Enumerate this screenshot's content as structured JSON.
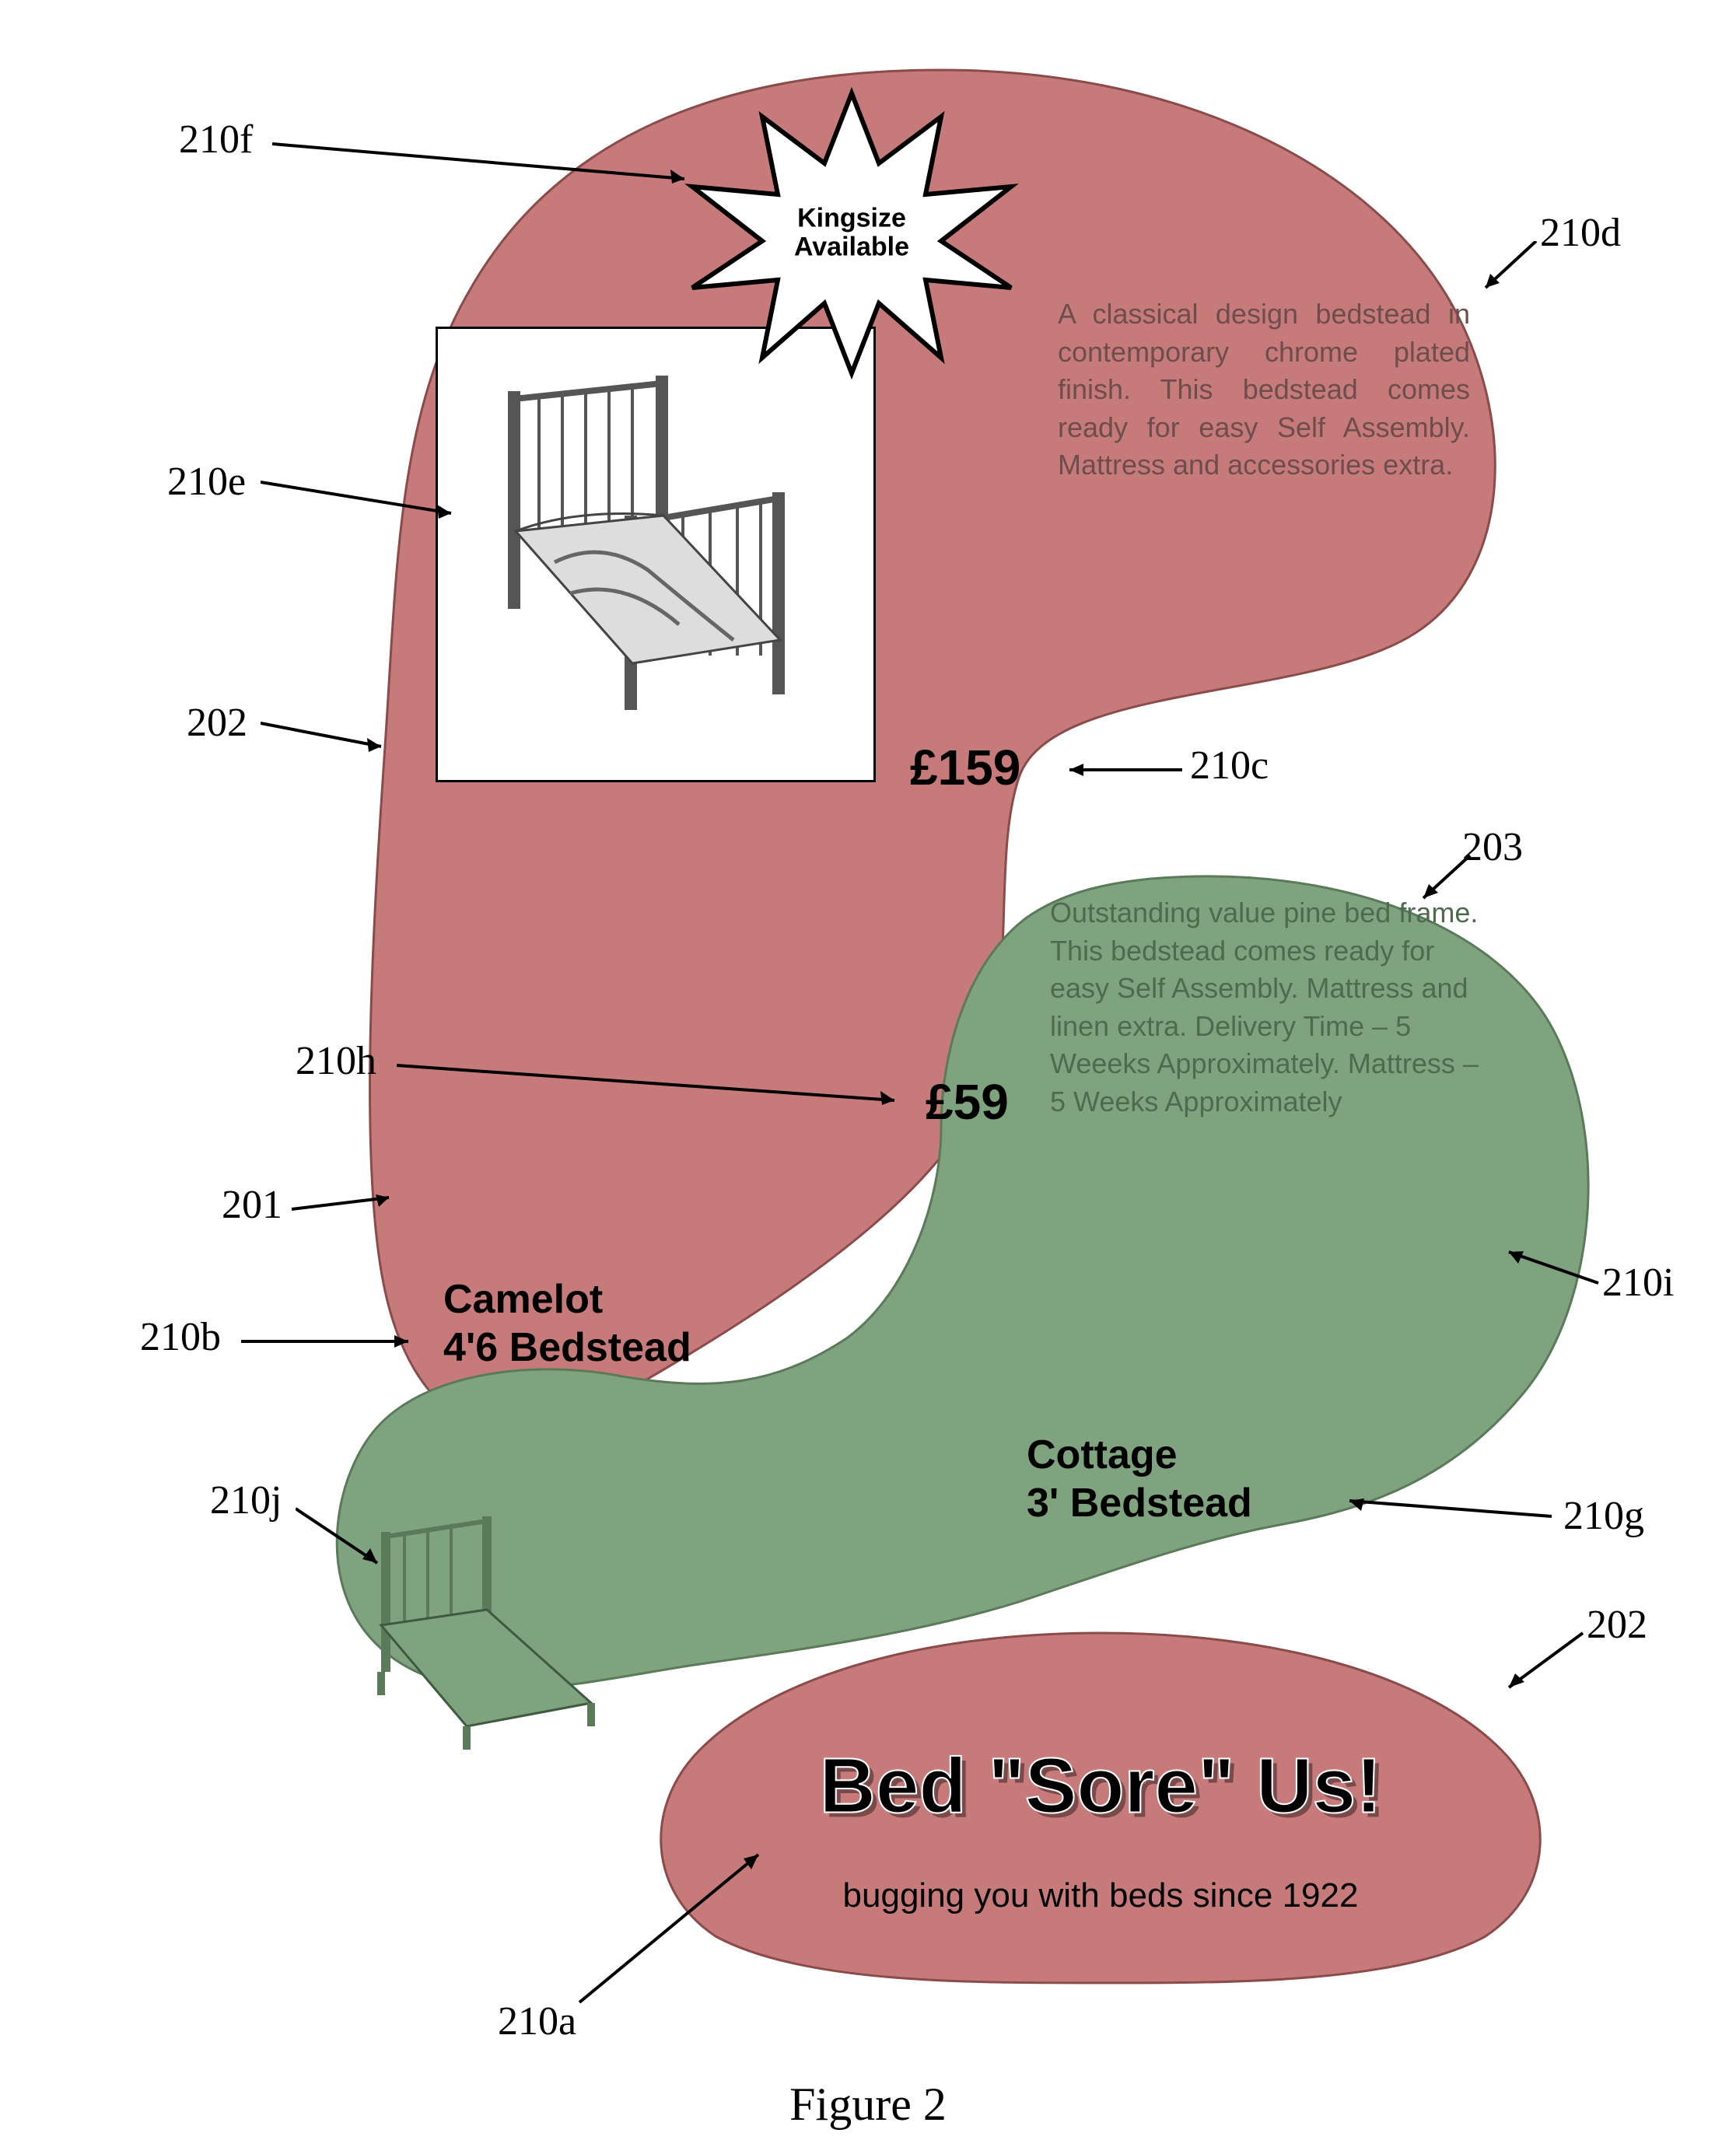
{
  "figure_caption": "Figure 2",
  "annotations": {
    "a210f": "210f",
    "a210d": "210d",
    "a210e": "210e",
    "a202_left": "202",
    "a210c": "210c",
    "a203": "203",
    "a210h": "210h",
    "a201": "201",
    "a210b": "210b",
    "a210i": "210i",
    "a210j": "210j",
    "a210g": "210g",
    "a202_right": "202",
    "a210a": "210a"
  },
  "starburst": {
    "line1": "Kingsize",
    "line2": "Available"
  },
  "camelot": {
    "title": "Camelot\n4'6 Bedstead",
    "price": "£159",
    "description": "A classical design bedstead in contemporary chrome plated finish. This bedstead comes ready for easy Self Assembly. Mattress and accessories extra."
  },
  "cottage": {
    "title": "Cottage\n3' Bedstead",
    "price": "£59",
    "description": "Outstanding value pine bed frame. This bedstead comes ready for easy Self Assembly. Mattress and linen extra.\nDelivery Time – 5 Weeeks Approximately.\nMattress – 5 Weeks Approximately"
  },
  "brand": {
    "name": "Bed \"Sore\" Us!",
    "tagline": "bugging you with beds since 1922"
  }
}
